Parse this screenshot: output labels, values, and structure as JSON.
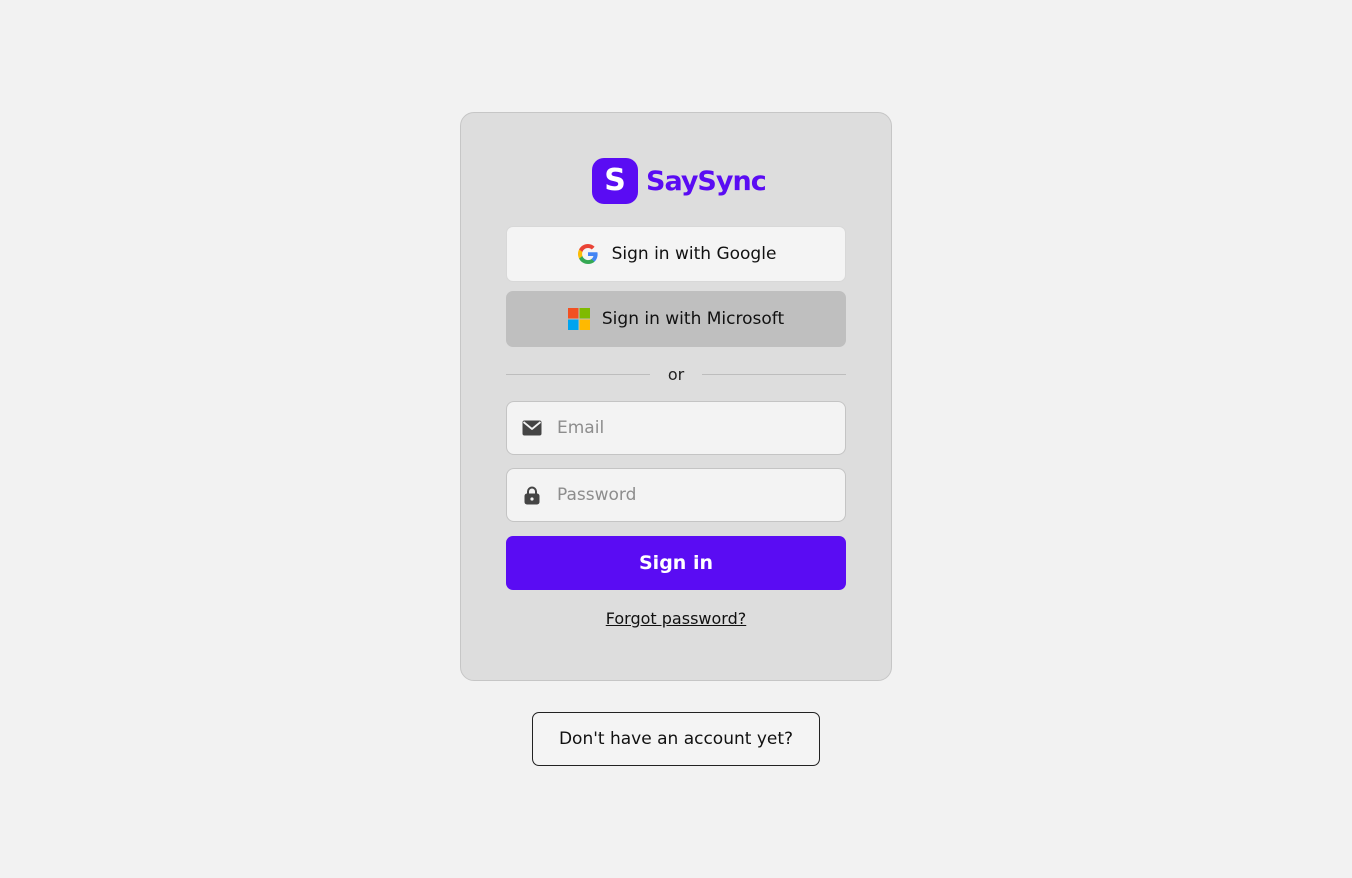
{
  "brand": {
    "mark_letter": "S",
    "name": "SaySync",
    "color": "#5a0cf3"
  },
  "sso": {
    "google_label": "Sign in with Google",
    "google_icon": "google-icon",
    "microsoft_label": "Sign in with Microsoft",
    "microsoft_icon": "microsoft-icon"
  },
  "divider": {
    "label": "or"
  },
  "form": {
    "email_placeholder": "Email",
    "email_value": "",
    "email_icon": "envelope-icon",
    "password_placeholder": "Password",
    "password_value": "",
    "password_icon": "lock-icon",
    "submit_label": "Sign in"
  },
  "links": {
    "forgot_password": "Forgot password?",
    "signup": "Don't have an account yet?"
  }
}
